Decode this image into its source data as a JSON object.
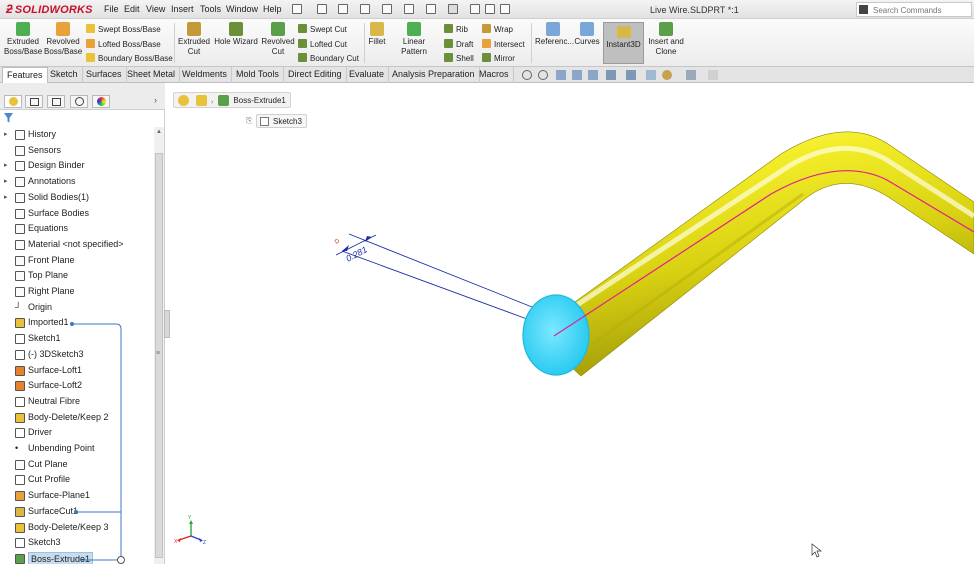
{
  "app": {
    "brand": "SOLIDWORKS",
    "window_title": "Live Wire.SLDPRT *:1",
    "menus": [
      "File",
      "Edit",
      "View",
      "Insert",
      "Tools",
      "Window",
      "Help"
    ],
    "search_placeholder": "Search Commands"
  },
  "command_manager": {
    "extruded_boss": "Extruded Boss/Base",
    "revolved_boss": "Revolved Boss/Base",
    "swept_boss": "Swept Boss/Base",
    "lofted_boss": "Lofted Boss/Base",
    "boundary_boss": "Boundary Boss/Base",
    "extruded_cut": "Extruded Cut",
    "hole_wizard": "Hole Wizard",
    "revolved_cut": "Revolved Cut",
    "swept_cut": "Swept Cut",
    "lofted_cut": "Lofted Cut",
    "boundary_cut": "Boundary Cut",
    "fillet": "Fillet",
    "linear_pattern": "Linear Pattern",
    "rib": "Rib",
    "draft": "Draft",
    "shell": "Shell",
    "wrap": "Wrap",
    "intersect": "Intersect",
    "mirror": "Mirror",
    "reference": "Referenc...",
    "curves": "Curves",
    "instant3d": "Instant3D",
    "insert_clone": "Insert and Clone"
  },
  "tabs": [
    "Features",
    "Sketch",
    "Surfaces",
    "Sheet Metal",
    "Weldments",
    "Mold Tools",
    "Direct Editing",
    "Evaluate",
    "Analysis Preparation",
    "Macros"
  ],
  "active_tab": "Features",
  "tree": [
    {
      "label": "History",
      "expandable": true,
      "icon": "history-icon"
    },
    {
      "label": "Sensors",
      "expandable": false,
      "icon": "sensors-icon"
    },
    {
      "label": "Design Binder",
      "expandable": true,
      "icon": "design-binder-icon"
    },
    {
      "label": "Annotations",
      "expandable": true,
      "icon": "annotations-icon"
    },
    {
      "label": "Solid Bodies(1)",
      "expandable": true,
      "icon": "solid-bodies-icon"
    },
    {
      "label": "Surface Bodies",
      "expandable": false,
      "icon": "surface-bodies-icon"
    },
    {
      "label": "Equations",
      "expandable": false,
      "icon": "equations-icon"
    },
    {
      "label": "Material <not specified>",
      "expandable": false,
      "icon": "material-icon"
    },
    {
      "label": "Front Plane",
      "expandable": false,
      "icon": "plane-icon"
    },
    {
      "label": "Top Plane",
      "expandable": false,
      "icon": "plane-icon"
    },
    {
      "label": "Right Plane",
      "expandable": false,
      "icon": "plane-icon"
    },
    {
      "label": "Origin",
      "expandable": false,
      "icon": "origin-icon"
    },
    {
      "label": "Imported1",
      "expandable": false,
      "icon": "imported-icon"
    },
    {
      "label": "Sketch1",
      "expandable": false,
      "icon": "sketch-icon"
    },
    {
      "label": "(-) 3DSketch3",
      "expandable": false,
      "icon": "3d-sketch-icon"
    },
    {
      "label": "Surface-Loft1",
      "expandable": false,
      "icon": "surface-loft-icon"
    },
    {
      "label": "Surface-Loft2",
      "expandable": false,
      "icon": "surface-loft-icon"
    },
    {
      "label": "Neutral Fibre",
      "expandable": false,
      "icon": "3d-sketch-icon"
    },
    {
      "label": "Body-Delete/Keep 2",
      "expandable": false,
      "icon": "body-delete-icon"
    },
    {
      "label": "Driver",
      "expandable": false,
      "icon": "sketch-icon"
    },
    {
      "label": "Unbending Point",
      "expandable": false,
      "icon": "point-icon"
    },
    {
      "label": "Cut Plane",
      "expandable": false,
      "icon": "plane-icon"
    },
    {
      "label": "Cut Profile",
      "expandable": false,
      "icon": "sketch-icon"
    },
    {
      "label": "Surface-Plane1",
      "expandable": false,
      "icon": "surface-plane-icon"
    },
    {
      "label": "SurfaceCut1",
      "expandable": false,
      "icon": "surface-cut-icon"
    },
    {
      "label": "Body-Delete/Keep 3",
      "expandable": false,
      "icon": "body-delete-icon"
    },
    {
      "label": "Sketch3",
      "expandable": false,
      "icon": "sketch-icon"
    },
    {
      "label": "Boss-Extrude1",
      "expandable": false,
      "icon": "boss-extrude-icon",
      "selected": true
    }
  ],
  "graphics": {
    "breadcrumb_label": "Boss-Extrude1",
    "sketch_crumb": "Sketch3",
    "dimension": "0.281"
  },
  "colors": {
    "model": "#e6e00f",
    "end_face": "#35d6f5",
    "path": "#e0208f",
    "dimension": "#1c2fa8",
    "selection": "#c6dcef"
  }
}
